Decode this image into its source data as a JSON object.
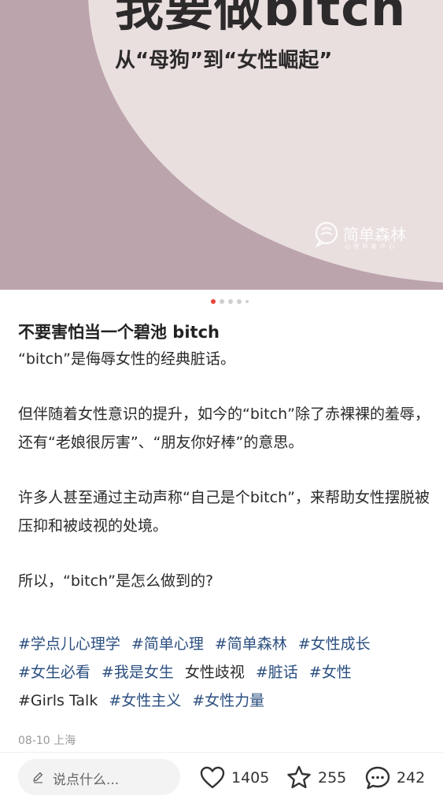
{
  "cover": {
    "title": "我要做bitch",
    "subtitle": "从“母狗”到“女性崛起”",
    "watermark": "简单森林",
    "watermark_sub": "心 理 科 普 中 心"
  },
  "carousel": {
    "total": 5,
    "active": 0
  },
  "post": {
    "title": "不要害怕当一个碧池 bitch",
    "paragraphs": [
      "“bitch”是侮辱女性的经典脏话。",
      "但伴随着女性意识的提升，如今的“bitch”除了赤裸裸的羞辱，还有“老娘很厉害”、“朋友你好棒”的意思。",
      "许多人甚至通过主动声称“自己是个bitch”，来帮助女性摆脱被压抑和被歧视的处境。",
      "所以，“bitch”是怎么做到的?"
    ],
    "tags": [
      {
        "text": "#学点儿心理学",
        "link": true
      },
      {
        "text": "#简单心理",
        "link": true
      },
      {
        "text": "#简单森林",
        "link": true
      },
      {
        "text": "#女性成长",
        "link": true
      },
      {
        "text": "#女生必看",
        "link": true
      },
      {
        "text": "#我是女生",
        "link": true
      },
      {
        "text": "女性歧视",
        "link": false
      },
      {
        "text": "#脏话",
        "link": true
      },
      {
        "text": "#女性",
        "link": true
      },
      {
        "text": "#Girls Talk",
        "link": false
      },
      {
        "text": "#女性主义",
        "link": true
      },
      {
        "text": "#女性力量",
        "link": true
      }
    ],
    "meta": "08-10 上海"
  },
  "bottom_bar": {
    "comment_placeholder": "说点什么...",
    "like_count": "1405",
    "collect_count": "255",
    "comment_count": "242"
  },
  "colors": {
    "accent": "#e8453c",
    "tag": "#2b4f80",
    "cover_bg": "#bca4ad",
    "cover_circle": "#eadfdf"
  },
  "icons": [
    "pencil-icon",
    "heart-icon",
    "star-icon",
    "comment-icon",
    "speech-bubble-logo-icon"
  ]
}
